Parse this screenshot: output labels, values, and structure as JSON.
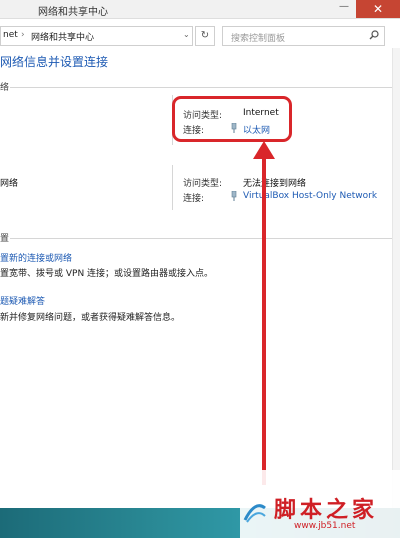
{
  "window": {
    "title": "网络和共享中心",
    "close_glyph": "✕",
    "minimize_glyph": "—"
  },
  "address_bar": {
    "crumbs": [
      "net",
      "网络和共享中心"
    ],
    "separator": "›",
    "dropdown_glyph": "⌄",
    "refresh_glyph": "↻"
  },
  "search": {
    "placeholder": "搜索控制面板",
    "icon": "search-icon"
  },
  "page": {
    "title": "网络信息并设置连接"
  },
  "active_networks": {
    "section_label": "络",
    "primary": {
      "access_type_label": "访问类型:",
      "access_type_value": "Internet",
      "connection_label": "连接:",
      "connection_value": "以太网"
    },
    "secondary": {
      "name": "网络",
      "access_type_label": "访问类型:",
      "access_type_value": "无法连接到网络",
      "connection_label": "连接:",
      "connection_value": "VirtualBox Host-Only Network"
    }
  },
  "change_settings": {
    "section_label": "置",
    "tasks": [
      {
        "link": "置新的连接或网络",
        "description": "置宽带、拨号或 VPN 连接；或设置路由器或接入点。"
      },
      {
        "link": "题疑难解答",
        "description": "新并修复网络问题，或者获得疑难解答信息。"
      }
    ]
  },
  "watermark": {
    "title": "脚本之家",
    "url": "www.jb51.net"
  },
  "colors": {
    "accent": "#1d5ab3",
    "annotation_red": "#d9262a",
    "close_red": "#c64533"
  }
}
